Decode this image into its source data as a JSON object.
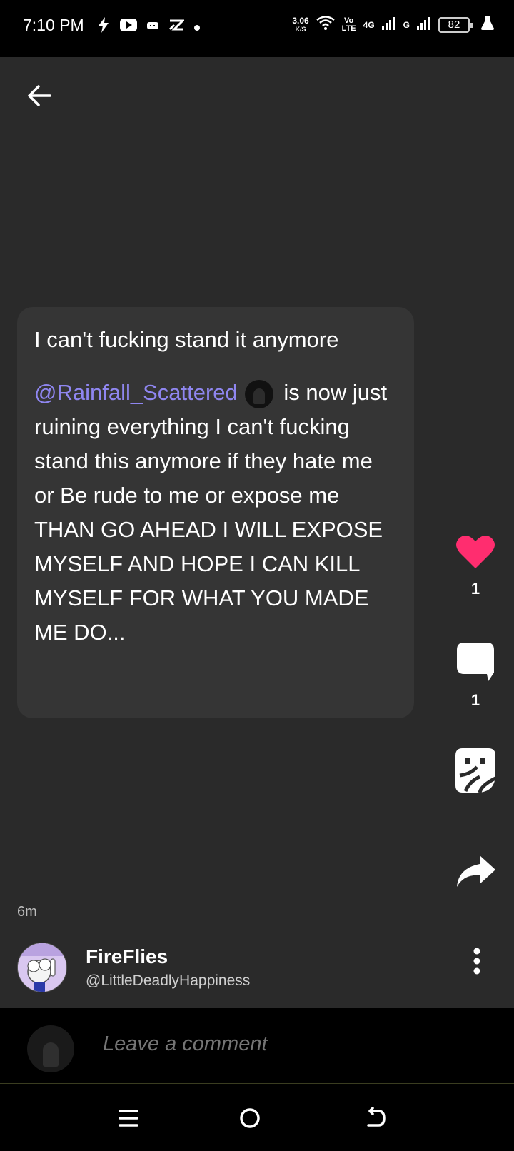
{
  "status_bar": {
    "time": "7:10 PM",
    "speed_value": "3.06",
    "speed_unit": "K/S",
    "volte_top": "Vo",
    "volte_bottom": "LTE",
    "network1": "4G",
    "network2": "G",
    "battery": "82"
  },
  "post": {
    "title": "I can't fucking stand it anymore",
    "mention": "@Rainfall_Scattered",
    "body_rest": " is now just ruining everything I can't fucking stand this anymore if they hate me or Be rude to me or expose me THAN GO AHEAD I WILL EXPOSE MYSELF AND HOPE I CAN KILL MYSELF FOR WHAT YOU MADE ME DO..."
  },
  "actions": {
    "like_count": "1",
    "comment_count": "1",
    "like_color": "#ff2d6f"
  },
  "meta": {
    "time_ago": "6m",
    "author_name": "FireFlies",
    "author_handle": "@LittleDeadlyHappiness"
  },
  "comment": {
    "placeholder": "Leave a comment"
  },
  "icons": {
    "back": "arrow-left-icon",
    "like": "heart-icon",
    "comment": "speech-bubble-icon",
    "sticker": "sticker-icon",
    "share": "share-arrow-icon",
    "more": "kebab-icon"
  }
}
